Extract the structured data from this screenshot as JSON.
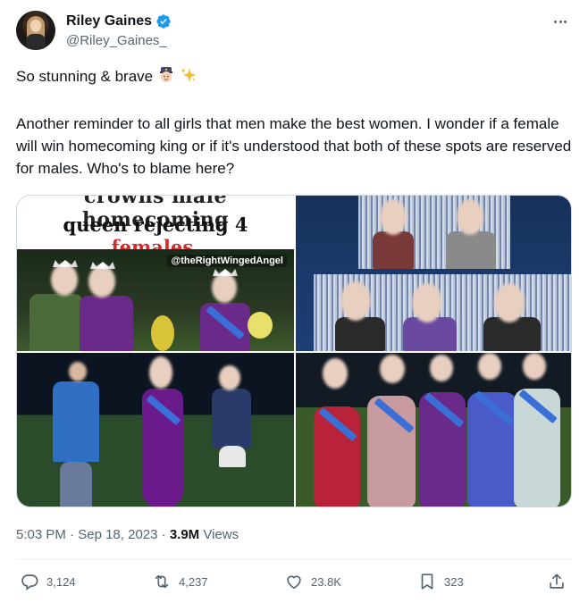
{
  "author": {
    "display_name": "Riley Gaines",
    "handle": "@Riley_Gaines_",
    "verified": true
  },
  "tweet": {
    "line1": "So stunning & brave",
    "line1_emojis": [
      "police-officer-emoji",
      "sparkles-emoji"
    ],
    "body": "Another reminder to all girls that men make the best women. I wonder if a female will win homecoming king or if it's understood that both of these spots are reserved for males. Who's to blame here?"
  },
  "media": {
    "meme_caption_cut": "crowns male homecoming",
    "meme_caption_prefix": "queen rejecting 4 ",
    "meme_caption_highlight": "females.",
    "meme_watermark": "@theRightWingedAngel"
  },
  "meta": {
    "time": "5:03 PM",
    "separator": " · ",
    "date": "Sep 18, 2023",
    "views_count": "3.9M",
    "views_label": " Views"
  },
  "actions": {
    "replies": "3,124",
    "retweets": "4,237",
    "likes": "23.8K",
    "bookmarks": "323"
  },
  "colors": {
    "accent": "#1d9bf0",
    "text_primary": "#0f1419",
    "text_secondary": "#536471",
    "divider": "#eff3f4",
    "meme_red": "#d32b2b"
  }
}
